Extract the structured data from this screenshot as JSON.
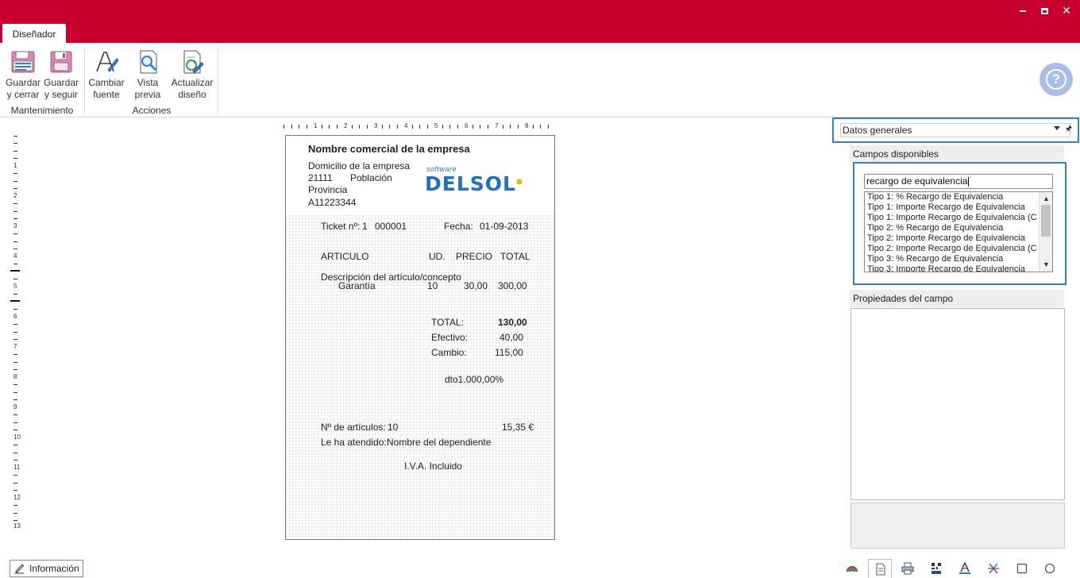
{
  "tab": "Diseñador",
  "ribbon": {
    "buttons": {
      "guardar_cerrar": [
        "Guardar",
        "y cerrar"
      ],
      "guardar_seguir": [
        "Guardar",
        "y seguir"
      ],
      "cambiar_fuente": [
        "Cambiar",
        "fuente"
      ],
      "vista_previa": [
        "Vista",
        "previa"
      ],
      "actualizar_diseno": [
        "Actualizar",
        "diseño"
      ]
    },
    "groups": {
      "mantenimiento": "Mantenimiento",
      "acciones": "Acciones"
    }
  },
  "ruler": {
    "horizontal": [
      "1",
      "2",
      "3",
      "4",
      "5",
      "6",
      "7",
      "8"
    ],
    "vertical": [
      "1",
      "2",
      "3",
      "4",
      "5",
      "6",
      "7",
      "8",
      "9",
      "10",
      "11",
      "12",
      "13"
    ]
  },
  "ticket": {
    "company_name": "Nombre  comercial de la empresa",
    "address": "Domicilio de la empresa",
    "postal_code": "21111",
    "city": "Población",
    "province": "Provincia",
    "tax_id": "A11223344",
    "logo_small": "software",
    "logo_big": "DELSOL",
    "ticket_label": "Ticket nº:",
    "ticket_series": "1",
    "ticket_number": "000001",
    "date_label": "Fecha:",
    "date_value": "01-09-2013",
    "col_articulo": "ARTICULO",
    "col_ud": "UD.",
    "col_precio": "PRECIO",
    "col_total": "TOTAL",
    "line_description": "Descripción del artículo/concepto",
    "line_item": "Garantía",
    "line_ud": "10",
    "line_precio": "30,00",
    "line_total": "300,00",
    "total_label": "TOTAL:",
    "total_value": "130,00",
    "efectivo_label": "Efectivo:",
    "efectivo_value": "40,00",
    "cambio_label": "Cambio:",
    "cambio_value": "115,00",
    "discount": "dto1.000,00%",
    "num_articulos_label": "Nº de artículos:",
    "num_articulos_value": "10",
    "amount": "15,35 €",
    "attended_label": "Le ha atendido:",
    "attended_value": "Nombre del dependiente",
    "iva_text": "I.V.A. Incluido"
  },
  "panel": {
    "combo_value": "Datos generales",
    "campos_title": "Campos disponibles",
    "search_value": "recargo de equivalencia",
    "fields": [
      "Tipo 1: % Recargo de Equivalencia",
      "Tipo 1: Importe Recargo de Equivalencia",
      "Tipo 1: Importe Recargo de Equivalencia (C",
      "Tipo 2: % Recargo de Equivalencia",
      "Tipo 2: Importe Recargo de Equivalencia",
      "Tipo 2: Importe Recargo de Equivalencia (C",
      "Tipo 3: % Recargo de Equivalencia",
      "Tipo 3: Importe Recargo de Equivalencia"
    ],
    "props_title": "Propiedades del campo"
  },
  "bottom": {
    "info_label": "Información"
  },
  "colors": {
    "brand_red": "#c8002e",
    "accent_blue": "#2a86c0",
    "help_blue": "#a9bde8"
  }
}
